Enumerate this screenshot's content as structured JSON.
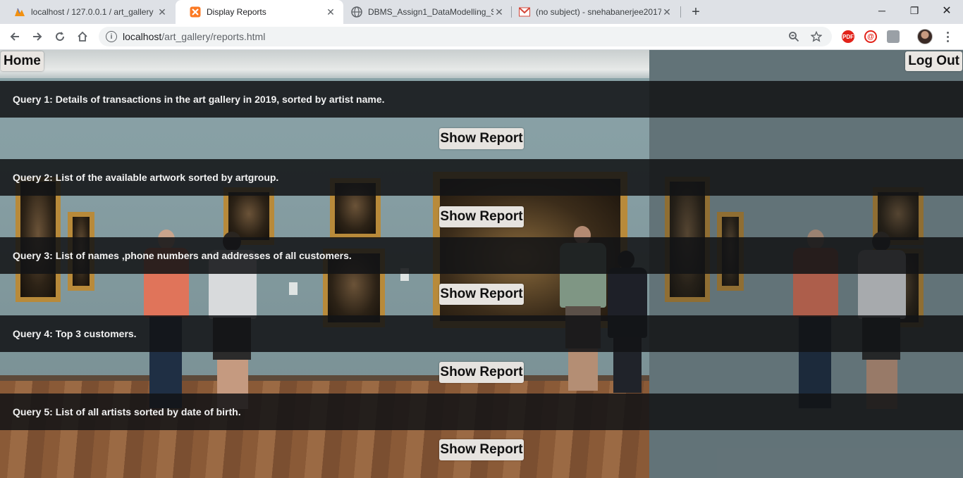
{
  "browser": {
    "tabs": [
      {
        "title": "localhost / 127.0.0.1 / art_gallery",
        "icon": "phpmyadmin-icon",
        "active": false
      },
      {
        "title": "Display Reports",
        "icon": "xampp-icon",
        "active": true
      },
      {
        "title": "DBMS_Assign1_DataModelling_S",
        "icon": "globe-icon",
        "active": false
      },
      {
        "title": "(no subject) - snehabanerjee2017",
        "icon": "gmail-icon",
        "active": false
      }
    ],
    "new_tab": "+",
    "url_host": "localhost",
    "url_path": "/art_gallery/reports.html",
    "window_controls": {
      "minimize": "─",
      "maximize": "❐",
      "close": "✕"
    }
  },
  "page": {
    "home_label": "Home",
    "logout_label": "Log Out",
    "queries": [
      {
        "text": "Query 1: Details of transactions in the art gallery in 2019, sorted by artist name.",
        "button": "Show Report"
      },
      {
        "text": "Query 2: List of the available artwork sorted by artgroup.",
        "button": "Show Report"
      },
      {
        "text": "Query 3: List of names ,phone numbers and addresses of all customers.",
        "button": "Show Report"
      },
      {
        "text": "Query 4: Top 3 customers.",
        "button": "Show Report"
      },
      {
        "text": "Query 5: List of all artists sorted by date of birth.",
        "button": "Show Report"
      }
    ]
  },
  "colors": {
    "band": "#121416",
    "button_bg": "#e6e3df",
    "frame_gold": "#b88a3a"
  }
}
